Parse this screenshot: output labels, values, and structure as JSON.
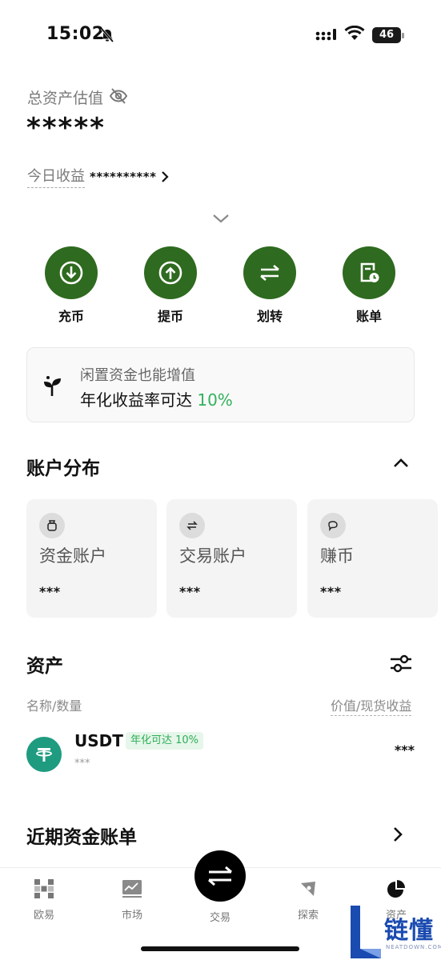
{
  "status_bar": {
    "time": "15:02",
    "battery": "46"
  },
  "header": {
    "total_label": "总资产估值",
    "total_value": "*****",
    "today_label": "今日收益",
    "today_value": "**********"
  },
  "actions": [
    {
      "label": "充币",
      "icon": "deposit-icon"
    },
    {
      "label": "提币",
      "icon": "withdraw-icon"
    },
    {
      "label": "划转",
      "icon": "transfer-icon"
    },
    {
      "label": "账单",
      "icon": "bill-icon"
    }
  ],
  "promo": {
    "subtitle": "闲置资金也能增值",
    "text": "年化收益率可达",
    "rate": "10%"
  },
  "distribution": {
    "title": "账户分布",
    "accounts": [
      {
        "name": "资金账户",
        "value": "***"
      },
      {
        "name": "交易账户",
        "value": "***"
      },
      {
        "name": "赚币",
        "value": "***"
      }
    ]
  },
  "assets": {
    "title": "资产",
    "col_left": "名称/数量",
    "col_right": "价值/现货收益",
    "rows": [
      {
        "name": "USDT",
        "tag": "年化可达 10%",
        "amount": "***",
        "value": "***"
      }
    ]
  },
  "recent": {
    "title": "近期资金账单"
  },
  "bottom_nav": {
    "items": [
      {
        "label": "欧易"
      },
      {
        "label": "市场"
      },
      {
        "label": "交易"
      },
      {
        "label": "探索"
      },
      {
        "label": "资产"
      }
    ]
  },
  "watermark": {
    "text": "链懂",
    "sub": "NEATDOWN.COM"
  },
  "colors": {
    "accent_green": "#2e6a1f",
    "rate_green": "#31b25c",
    "usdt_teal": "#1f9b80"
  }
}
